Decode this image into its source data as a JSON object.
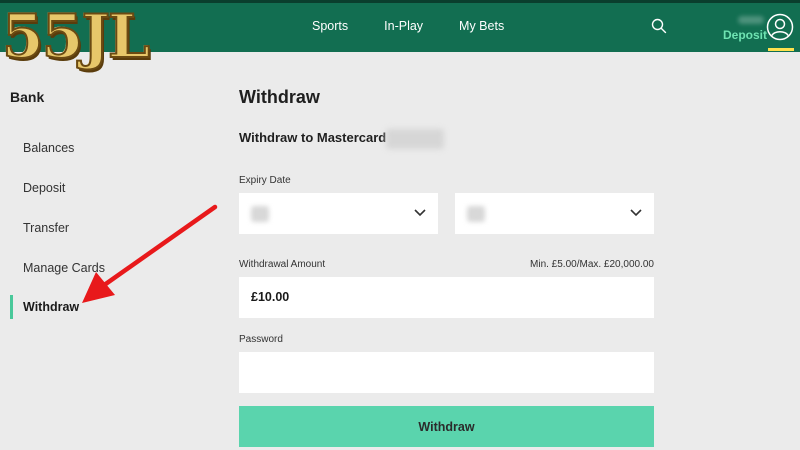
{
  "header": {
    "logo_text": "55JL",
    "nav": [
      "Sports",
      "In-Play",
      "My Bets"
    ],
    "deposit_label": "Deposit",
    "icons": [
      "search-icon",
      "account-icon"
    ]
  },
  "sidebar": {
    "title": "Bank",
    "items": [
      {
        "label": "Balances"
      },
      {
        "label": "Deposit"
      },
      {
        "label": "Transfer"
      },
      {
        "label": "Manage Cards"
      },
      {
        "label": "Withdraw",
        "active": true
      }
    ]
  },
  "main": {
    "title": "Withdraw",
    "subtitle": "Withdraw to Mastercard",
    "expiry_label": "Expiry Date",
    "amount_label": "Withdrawal Amount",
    "amount_limits": "Min. £5.00/Max. £20,000.00",
    "amount_value": "£10.00",
    "password_label": "Password",
    "submit_label": "Withdraw"
  },
  "colors": {
    "header_bg": "#126e51",
    "accent": "#5ad4ad",
    "deposit_text": "#6fe3b2",
    "highlight": "#ffe14d",
    "annotation_arrow": "#e8191b"
  }
}
